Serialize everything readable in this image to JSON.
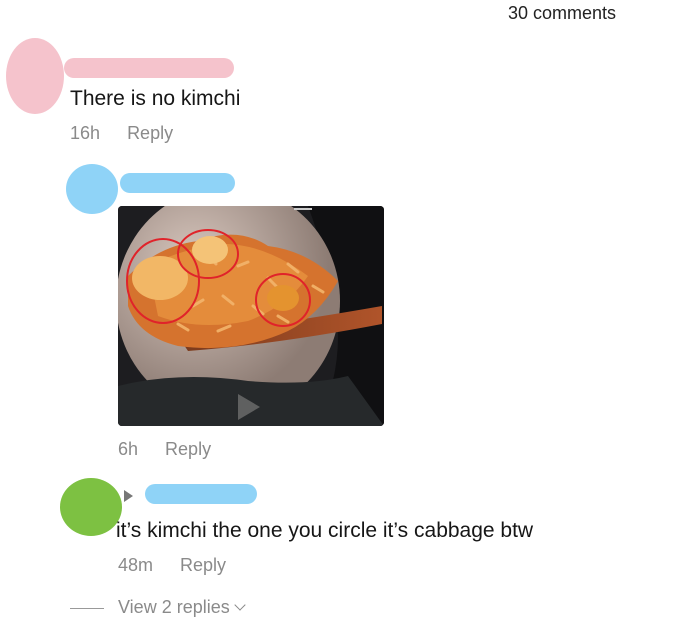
{
  "header": {
    "comments_count": "30 comments"
  },
  "comments": [
    {
      "text": "There is no kimchi",
      "time": "16h",
      "reply_label": "Reply"
    },
    {
      "text": "",
      "time": "6h",
      "reply_label": "Reply",
      "has_photo": true
    },
    {
      "text": "it’s kimchi the one you circle it’s cabbage btw",
      "time": "48m",
      "reply_label": "Reply",
      "view_replies": "View 2 replies"
    }
  ],
  "colors": {
    "pink_redaction": "#f5c3cc",
    "blue_redaction": "#8fd3f7",
    "green_redaction": "#7dc142",
    "circle_annotation": "#e0232a"
  }
}
